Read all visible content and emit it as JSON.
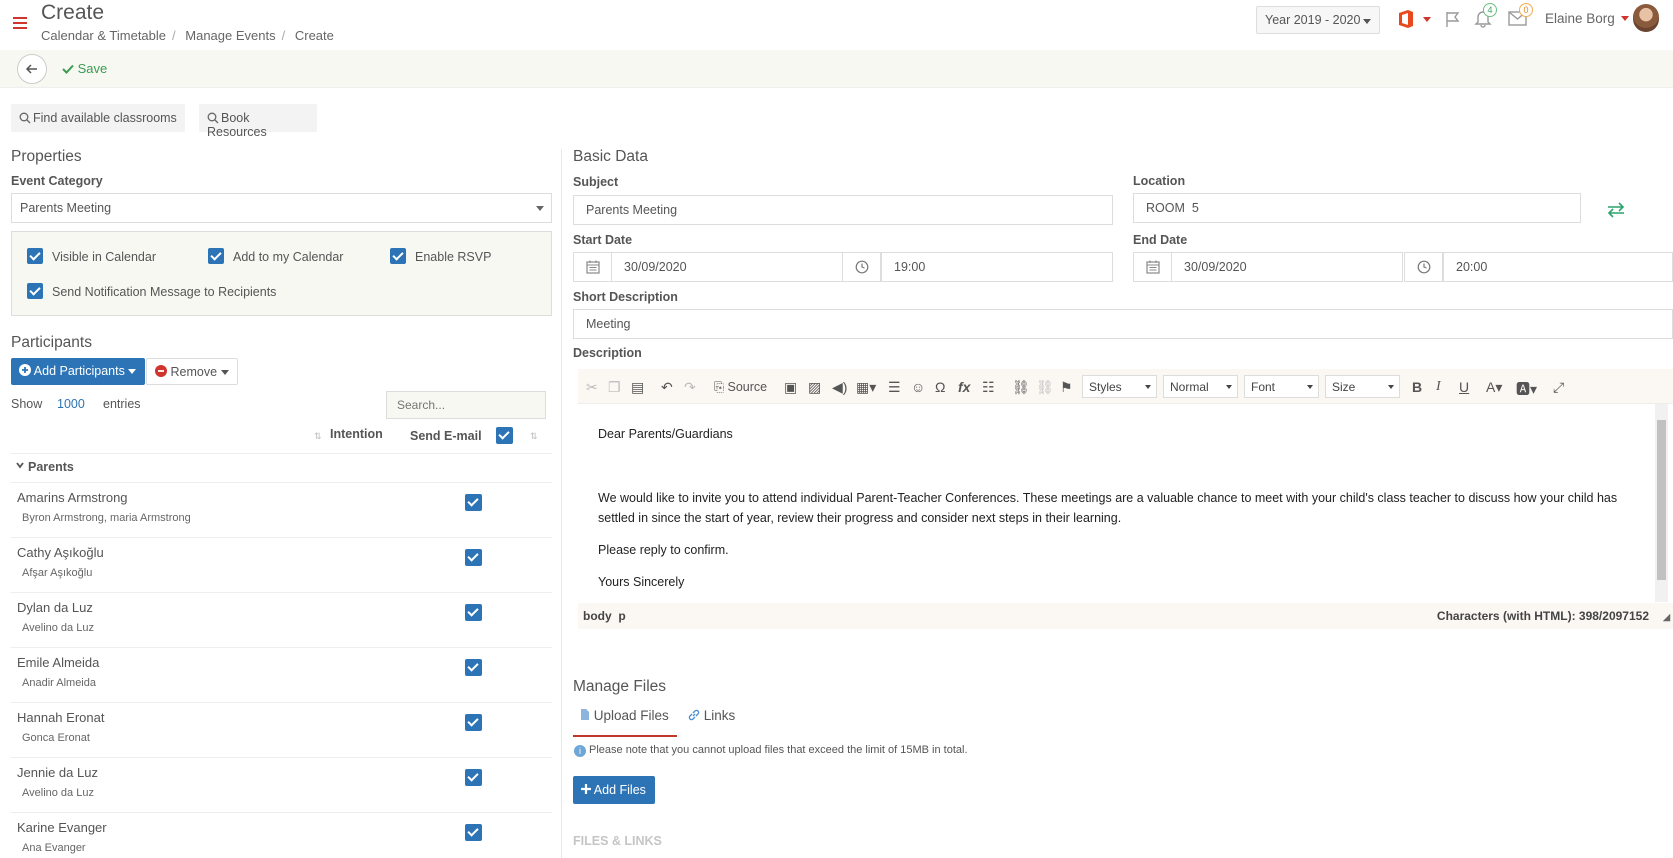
{
  "header": {
    "title": "Create",
    "breadcrumb": [
      "Calendar & Timetable",
      "Manage Events",
      "Create"
    ],
    "year_select": "Year 2019 - 2020",
    "notifications_count": "4",
    "messages_count": "0",
    "user_name": "Elaine Borg"
  },
  "actions": {
    "save_label": "Save"
  },
  "tools": {
    "find_classrooms": "Find available classrooms",
    "book_resources": "Book Resources"
  },
  "properties": {
    "title": "Properties",
    "event_category_label": "Event Category",
    "event_category_value": "Parents Meeting",
    "options": [
      {
        "label": "Visible in Calendar",
        "checked": true
      },
      {
        "label": "Add to my Calendar",
        "checked": true
      },
      {
        "label": "Enable RSVP",
        "checked": true
      },
      {
        "label": "Send Notification Message to Recipients",
        "checked": true
      }
    ]
  },
  "participants": {
    "title": "Participants",
    "add_label": "Add Participants",
    "remove_label": "Remove",
    "show_label": "Show",
    "show_value": "1000",
    "entries_label": "entries",
    "search_placeholder": "Search...",
    "col_intention": "Intention",
    "col_send_email": "Send E-mail",
    "group": "Parents",
    "rows": [
      {
        "name": "Amarins Armstrong",
        "sub": "Byron Armstrong, maria Armstrong",
        "send_email": true
      },
      {
        "name": "Cathy Aşıkoğlu",
        "sub": "Afşar Aşıkoğlu",
        "send_email": true
      },
      {
        "name": "Dylan da Luz",
        "sub": "Avelino da Luz",
        "send_email": true
      },
      {
        "name": "Emile Almeida",
        "sub": "Anadir Almeida",
        "send_email": true
      },
      {
        "name": "Hannah Eronat",
        "sub": "Gonca Eronat",
        "send_email": true
      },
      {
        "name": "Jennie da Luz",
        "sub": "Avelino da Luz",
        "send_email": true
      },
      {
        "name": "Karine Evanger",
        "sub": "Ana Evanger",
        "send_email": true
      }
    ]
  },
  "basic": {
    "title": "Basic Data",
    "subject_label": "Subject",
    "subject_value": "Parents Meeting",
    "location_label": "Location",
    "location_value": "ROOM  5",
    "start_label": "Start Date",
    "start_date": "30/09/2020",
    "start_time": "19:00",
    "end_label": "End Date",
    "end_date": "30/09/2020",
    "end_time": "20:00",
    "short_desc_label": "Short Description",
    "short_desc_value": "Meeting",
    "desc_label": "Description"
  },
  "editor": {
    "source_label": "Source",
    "styles": "Styles",
    "format": "Normal",
    "font": "Font",
    "size": "Size",
    "paragraphs": [
      "Dear Parents/Guardians",
      "",
      "We would like to invite you to attend individual Parent-Teacher Conferences. These meetings are a valuable chance to meet with your child's class teacher to discuss how your child has settled in since the start of year, review their progress and consider next steps in their learning.",
      "Please reply to confirm.",
      "Yours Sincerely"
    ],
    "path": "body  p",
    "char_count": "Characters (with HTML): 398/2097152"
  },
  "files": {
    "title": "Manage Files",
    "tab_upload": "Upload Files",
    "tab_links": "Links",
    "note": "Please note that you cannot upload files that exceed the limit of 15MB in total.",
    "add_label": "Add Files",
    "files_heading": "FILES & LINKS"
  },
  "colors": {
    "accent": "#2d74b6",
    "brand_red": "#d0342c",
    "success": "#3a9b52"
  }
}
